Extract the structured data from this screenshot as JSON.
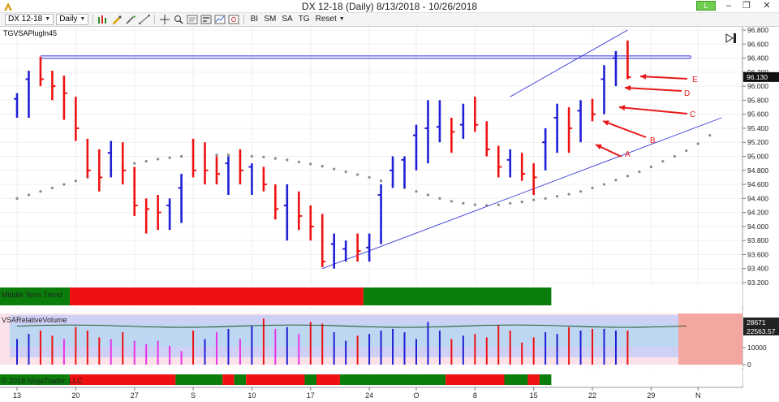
{
  "window": {
    "title": "DX 12-18 (Daily)  8/13/2018 - 10/26/2018",
    "link_label": "L",
    "minimize": "‒",
    "maximize": "❐",
    "close": "✕"
  },
  "toolbar": {
    "instrument": "DX 12-18",
    "interval": "Daily",
    "buttons": [
      "BI",
      "SM",
      "SA",
      "TG",
      "Reset"
    ],
    "icons": [
      "bar-style-icon",
      "pencil-icon",
      "magic-wand-icon",
      "drawing-tools-icon",
      "crosshair-icon",
      "zoom-icon",
      "data-box-icon",
      "properties-icon",
      "indicators-icon",
      "strategies-icon"
    ]
  },
  "indicator_label": "TGVSAPlugIn45",
  "panel_labels": {
    "trend": "Middle Term Trend",
    "volume": "VSARelativeVolume",
    "bottom": "© 2018 NinjaTrader, LLC"
  },
  "price_axis": {
    "ticks": [
      "96.800",
      "96.600",
      "96.400",
      "96.200",
      "96.000",
      "95.800",
      "95.600",
      "95.400",
      "95.200",
      "95.000",
      "94.800",
      "94.600",
      "94.400",
      "94.200",
      "94.000",
      "93.800",
      "93.600",
      "93.400",
      "93.200"
    ],
    "current_price": "96.130",
    "colors": {
      "up": "#1f1fd6",
      "down": "#ee1111",
      "channel": "#3a3ad9",
      "resistance": "#2c2cdc",
      "dots": "#888888"
    }
  },
  "volume_axis": {
    "ticks": [
      "10000",
      "0"
    ],
    "flags": [
      "28671",
      "22563.57"
    ]
  },
  "x_axis": {
    "labels": [
      "13",
      "20",
      "27",
      "S",
      "10",
      "17",
      "24",
      "O",
      "8",
      "15",
      "22",
      "29",
      "N"
    ]
  },
  "annotations": [
    "A",
    "B",
    "C",
    "D",
    "E"
  ],
  "chart_data": {
    "type": "ohlc",
    "instrument": "DX 12-18",
    "interval": "Daily",
    "date_range": "8/13/2018 - 10/26/2018",
    "ylim": [
      93.2,
      96.8
    ],
    "bars": [
      {
        "h": 95.9,
        "l": 95.55,
        "c": 95.82,
        "dir": "up"
      },
      {
        "h": 96.22,
        "l": 95.55,
        "c": 96.1,
        "dir": "up"
      },
      {
        "h": 96.42,
        "l": 96.0,
        "c": 96.1,
        "dir": "down"
      },
      {
        "h": 96.22,
        "l": 95.8,
        "c": 96.0,
        "dir": "down"
      },
      {
        "h": 96.15,
        "l": 95.52,
        "c": 95.9,
        "dir": "down"
      },
      {
        "h": 95.85,
        "l": 95.22,
        "c": 95.4,
        "dir": "down"
      },
      {
        "h": 95.25,
        "l": 94.7,
        "c": 94.8,
        "dir": "down"
      },
      {
        "h": 95.1,
        "l": 94.5,
        "c": 94.7,
        "dir": "down"
      },
      {
        "h": 95.22,
        "l": 94.7,
        "c": 95.05,
        "dir": "up"
      },
      {
        "h": 95.2,
        "l": 94.6,
        "c": 94.8,
        "dir": "down"
      },
      {
        "h": 94.85,
        "l": 94.15,
        "c": 94.3,
        "dir": "down"
      },
      {
        "h": 94.4,
        "l": 93.9,
        "c": 94.25,
        "dir": "down"
      },
      {
        "h": 94.45,
        "l": 93.95,
        "c": 94.2,
        "dir": "down"
      },
      {
        "h": 94.4,
        "l": 93.95,
        "c": 94.3,
        "dir": "up"
      },
      {
        "h": 94.75,
        "l": 94.05,
        "c": 94.55,
        "dir": "up"
      },
      {
        "h": 95.25,
        "l": 94.7,
        "c": 94.8,
        "dir": "down"
      },
      {
        "h": 95.2,
        "l": 94.6,
        "c": 94.8,
        "dir": "down"
      },
      {
        "h": 95.0,
        "l": 94.6,
        "c": 94.75,
        "dir": "down"
      },
      {
        "h": 95.0,
        "l": 94.45,
        "c": 94.9,
        "dir": "up"
      },
      {
        "h": 95.1,
        "l": 94.6,
        "c": 94.8,
        "dir": "down"
      },
      {
        "h": 94.9,
        "l": 94.45,
        "c": 94.85,
        "dir": "up"
      },
      {
        "h": 94.85,
        "l": 94.5,
        "c": 94.6,
        "dir": "down"
      },
      {
        "h": 94.6,
        "l": 94.1,
        "c": 94.25,
        "dir": "down"
      },
      {
        "h": 94.6,
        "l": 93.8,
        "c": 94.3,
        "dir": "up"
      },
      {
        "h": 94.5,
        "l": 93.95,
        "c": 94.15,
        "dir": "down"
      },
      {
        "h": 94.3,
        "l": 93.8,
        "c": 94.0,
        "dir": "down"
      },
      {
        "h": 94.18,
        "l": 93.42,
        "c": 93.5,
        "dir": "down"
      },
      {
        "h": 93.9,
        "l": 93.4,
        "c": 93.75,
        "dir": "up"
      },
      {
        "h": 93.8,
        "l": 93.5,
        "c": 93.68,
        "dir": "up"
      },
      {
        "h": 93.9,
        "l": 93.5,
        "c": 93.65,
        "dir": "down"
      },
      {
        "h": 93.9,
        "l": 93.5,
        "c": 93.7,
        "dir": "up"
      },
      {
        "h": 94.6,
        "l": 93.75,
        "c": 94.45,
        "dir": "up"
      },
      {
        "h": 95.0,
        "l": 94.55,
        "c": 94.8,
        "dir": "up"
      },
      {
        "h": 95.0,
        "l": 94.55,
        "c": 94.95,
        "dir": "up"
      },
      {
        "h": 95.45,
        "l": 94.8,
        "c": 95.3,
        "dir": "up"
      },
      {
        "h": 95.8,
        "l": 94.9,
        "c": 95.4,
        "dir": "up"
      },
      {
        "h": 95.8,
        "l": 95.2,
        "c": 95.42,
        "dir": "up"
      },
      {
        "h": 95.55,
        "l": 95.05,
        "c": 95.35,
        "dir": "down"
      },
      {
        "h": 95.75,
        "l": 95.25,
        "c": 95.45,
        "dir": "up"
      },
      {
        "h": 95.85,
        "l": 95.35,
        "c": 95.45,
        "dir": "down"
      },
      {
        "h": 95.5,
        "l": 95.0,
        "c": 95.1,
        "dir": "down"
      },
      {
        "h": 95.15,
        "l": 94.7,
        "c": 94.85,
        "dir": "down"
      },
      {
        "h": 95.1,
        "l": 94.7,
        "c": 94.95,
        "dir": "up"
      },
      {
        "h": 95.05,
        "l": 94.65,
        "c": 94.75,
        "dir": "down"
      },
      {
        "h": 94.9,
        "l": 94.45,
        "c": 94.7,
        "dir": "down"
      },
      {
        "h": 95.4,
        "l": 94.8,
        "c": 95.2,
        "dir": "up"
      },
      {
        "h": 95.75,
        "l": 95.05,
        "c": 95.55,
        "dir": "up"
      },
      {
        "h": 95.7,
        "l": 95.05,
        "c": 95.4,
        "dir": "down"
      },
      {
        "h": 95.8,
        "l": 95.2,
        "c": 95.65,
        "dir": "up"
      },
      {
        "h": 95.82,
        "l": 95.5,
        "c": 95.6,
        "dir": "down"
      },
      {
        "h": 96.3,
        "l": 95.6,
        "c": 96.1,
        "dir": "up"
      },
      {
        "h": 96.5,
        "l": 96.0,
        "c": 96.4,
        "dir": "up"
      },
      {
        "h": 96.65,
        "l": 96.1,
        "c": 96.13,
        "dir": "down"
      }
    ],
    "trend_dots": [
      94.4,
      94.45,
      94.5,
      94.55,
      94.6,
      94.65,
      94.7,
      94.75,
      94.8,
      94.85,
      94.9,
      94.93,
      94.96,
      94.98,
      95.0,
      95.01,
      95.02,
      95.02,
      95.02,
      95.01,
      95.0,
      94.99,
      94.97,
      94.95,
      94.92,
      94.89,
      94.86,
      94.82,
      94.78,
      94.74,
      94.7,
      94.65,
      94.6,
      94.55,
      94.5,
      94.45,
      94.4,
      94.36,
      94.33,
      94.31,
      94.3,
      94.31,
      94.33,
      94.35,
      94.38,
      94.4,
      94.43,
      94.46,
      94.5,
      94.55,
      94.6,
      94.66,
      94.72,
      94.78,
      94.85,
      94.93,
      95.0,
      95.08,
      95.18,
      95.3
    ],
    "resistance_level": 96.42,
    "channel": {
      "upper": [
        [
          42,
          95.85
        ],
        [
          52,
          96.8
        ]
      ],
      "lower": [
        [
          26,
          93.4
        ],
        [
          60,
          95.55
        ]
      ]
    },
    "trend_segments": [
      {
        "from": 0,
        "to": 5,
        "state": "up"
      },
      {
        "from": 5,
        "to": 30,
        "state": "down"
      },
      {
        "from": 30,
        "to": 46,
        "state": "up"
      }
    ],
    "volume": [
      {
        "v": 15000,
        "c": "blue"
      },
      {
        "v": 18000,
        "c": "blue"
      },
      {
        "v": 20000,
        "c": "red"
      },
      {
        "v": 17000,
        "c": "red"
      },
      {
        "v": 15000,
        "c": "magenta"
      },
      {
        "v": 22000,
        "c": "red"
      },
      {
        "v": 20000,
        "c": "red"
      },
      {
        "v": 16000,
        "c": "red"
      },
      {
        "v": 15000,
        "c": "magenta"
      },
      {
        "v": 19000,
        "c": "red"
      },
      {
        "v": 14000,
        "c": "magenta"
      },
      {
        "v": 12000,
        "c": "magenta"
      },
      {
        "v": 14000,
        "c": "magenta"
      },
      {
        "v": 11000,
        "c": "magenta"
      },
      {
        "v": 8000,
        "c": "magenta"
      },
      {
        "v": 20000,
        "c": "red"
      },
      {
        "v": 15000,
        "c": "blue"
      },
      {
        "v": 19000,
        "c": "magenta"
      },
      {
        "v": 21000,
        "c": "blue"
      },
      {
        "v": 15000,
        "c": "magenta"
      },
      {
        "v": 23000,
        "c": "blue"
      },
      {
        "v": 27000,
        "c": "red"
      },
      {
        "v": 21000,
        "c": "magenta"
      },
      {
        "v": 22000,
        "c": "blue"
      },
      {
        "v": 18000,
        "c": "magenta"
      },
      {
        "v": 25000,
        "c": "red"
      },
      {
        "v": 24000,
        "c": "red"
      },
      {
        "v": 19000,
        "c": "blue"
      },
      {
        "v": 14000,
        "c": "blue"
      },
      {
        "v": 17000,
        "c": "red"
      },
      {
        "v": 18000,
        "c": "blue"
      },
      {
        "v": 20000,
        "c": "blue"
      },
      {
        "v": 21000,
        "c": "blue"
      },
      {
        "v": 19000,
        "c": "blue"
      },
      {
        "v": 15000,
        "c": "blue"
      },
      {
        "v": 25000,
        "c": "blue"
      },
      {
        "v": 20000,
        "c": "blue"
      },
      {
        "v": 15000,
        "c": "red"
      },
      {
        "v": 17000,
        "c": "blue"
      },
      {
        "v": 18000,
        "c": "red"
      },
      {
        "v": 16000,
        "c": "red"
      },
      {
        "v": 23000,
        "c": "red"
      },
      {
        "v": 20000,
        "c": "red"
      },
      {
        "v": 13000,
        "c": "red"
      },
      {
        "v": 16000,
        "c": "red"
      },
      {
        "v": 19000,
        "c": "blue"
      },
      {
        "v": 18000,
        "c": "blue"
      },
      {
        "v": 22000,
        "c": "red"
      },
      {
        "v": 20000,
        "c": "blue"
      },
      {
        "v": 21000,
        "c": "red"
      },
      {
        "v": 21000,
        "c": "blue"
      },
      {
        "v": 20000,
        "c": "blue"
      },
      {
        "v": 20000,
        "c": "red"
      }
    ],
    "volume_average": 22563.57,
    "volume_ylim": [
      0,
      30000
    ],
    "bottom_segments": [
      {
        "from": 0,
        "to": 5,
        "state": "up"
      },
      {
        "from": 5,
        "to": 14,
        "state": "down"
      },
      {
        "from": 14,
        "to": 18,
        "state": "up"
      },
      {
        "from": 18,
        "to": 19,
        "state": "down"
      },
      {
        "from": 19,
        "to": 20,
        "state": "up"
      },
      {
        "from": 20,
        "to": 25,
        "state": "down"
      },
      {
        "from": 25,
        "to": 26,
        "state": "up"
      },
      {
        "from": 26,
        "to": 28,
        "state": "down"
      },
      {
        "from": 28,
        "to": 37,
        "state": "up"
      },
      {
        "from": 37,
        "to": 42,
        "state": "down"
      },
      {
        "from": 42,
        "to": 44,
        "state": "up"
      },
      {
        "from": 44,
        "to": 45,
        "state": "down"
      },
      {
        "from": 45,
        "to": 46,
        "state": "up"
      }
    ]
  }
}
